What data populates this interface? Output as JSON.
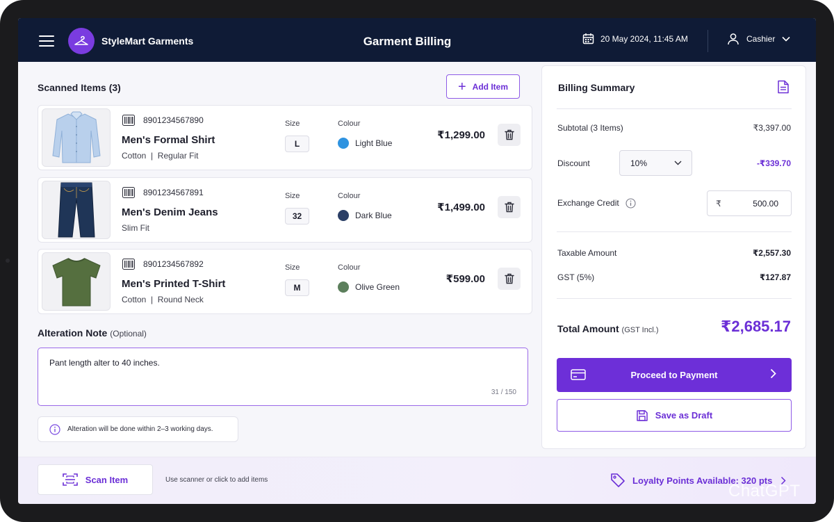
{
  "header": {
    "brand": "StyleMart Garments",
    "title": "Garment Billing",
    "datetime": "20 May 2024, 11:45 AM",
    "user": "Cashier"
  },
  "scanned": {
    "title": "Scanned Items (3)",
    "add_label": "Add Item",
    "size_label": "Size",
    "colour_label": "Colour",
    "items": [
      {
        "barcode": "8901234567890",
        "name": "Men's Formal Shirt",
        "desc": "Cotton  |  Regular Fit",
        "size": "L",
        "colour": "Light Blue",
        "colour_hex": "#2f93e0",
        "price": "₹1,299.00",
        "image_icon": "shirt-icon"
      },
      {
        "barcode": "8901234567891",
        "name": "Men's Denim Jeans",
        "desc": "Slim Fit",
        "size": "32",
        "colour": "Dark Blue",
        "colour_hex": "#2b3f66",
        "price": "₹1,499.00",
        "image_icon": "jeans-icon"
      },
      {
        "barcode": "8901234567892",
        "name": "Men's Printed T-Shirt",
        "desc": "Cotton  |  Round Neck",
        "size": "M",
        "colour": "Olive Green",
        "colour_hex": "#5c7f5c",
        "price": "₹599.00",
        "image_icon": "tshirt-icon"
      }
    ]
  },
  "alteration": {
    "title": "Alteration Note",
    "optional": "(Optional)",
    "value": "Pant length alter to 40 inches.",
    "count": "31 / 150",
    "info": "Alteration will be done within 2–3 working days."
  },
  "summary": {
    "title": "Billing Summary",
    "subtotal_label": "Subtotal (3 Items)",
    "subtotal": "₹3,397.00",
    "discount_label": "Discount",
    "discount_option": "10%",
    "discount_value": "-₹339.70",
    "exchange_label": "Exchange Credit",
    "exchange_currency": "₹",
    "exchange_value": "500.00",
    "taxable_label": "Taxable Amount",
    "taxable": "₹2,557.30",
    "gst_label": "GST (5%)",
    "gst": "₹127.87",
    "total_label": "Total Amount",
    "total_note": "(GST Incl.)",
    "total": "₹2,685.17",
    "pay_label": "Proceed to Payment",
    "draft_label": "Save as Draft"
  },
  "footer": {
    "scan_label": "Scan Item",
    "scan_hint": "Use scanner or click to add items",
    "loyalty": "Loyalty Points Available: 320 pts"
  },
  "watermark": "ChatGPT",
  "colors": {
    "accent": "#6d2fd8",
    "header_bg": "#0f1b36"
  }
}
